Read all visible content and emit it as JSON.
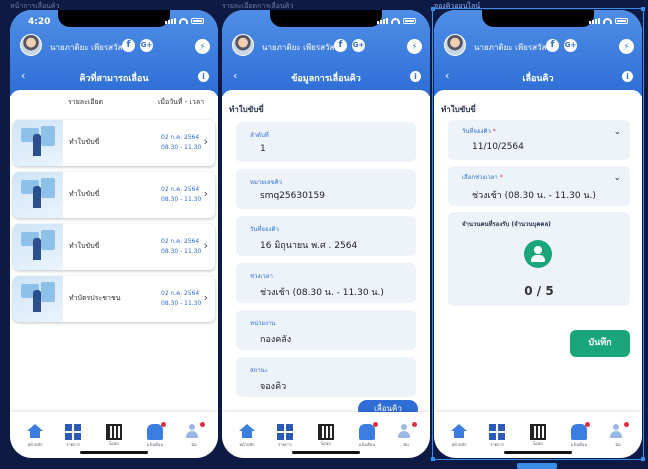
{
  "captions": [
    "หน้าการเลื่อนคิว",
    "รายละเอียดการเลื่อนคิว",
    "จองคิวออนไลน์"
  ],
  "status_time": "4:20",
  "user_name": "นายภาติยะ เพียรสวัสดิ์",
  "screen1": {
    "title": "คิวที่สามารถเลื่อน",
    "col_detail": "รายละเอียด",
    "col_date": "เมื่อวันที่ - เวลา",
    "items": [
      {
        "label": "ทำใบขับขี่",
        "date": "02 ก.ค. 2564",
        "time": "08.30 - 11.30"
      },
      {
        "label": "ทำใบขับขี่",
        "date": "02 ก.ค. 2564",
        "time": "08.30 - 11.30"
      },
      {
        "label": "ทำใบขับขี่",
        "date": "02 ก.ค. 2564",
        "time": "08.30 - 11.30"
      },
      {
        "label": "ทำบัตรประชาชน",
        "date": "02 ก.ค. 2564",
        "time": "08.30 - 11.30"
      }
    ]
  },
  "screen2": {
    "title": "ข้อมูลการเลื่อนคิว",
    "section": "ทำใบขับขี่",
    "fields": [
      {
        "label": "ลำดับที่",
        "value": "1"
      },
      {
        "label": "หมายเลขคิว",
        "value": "smq25630159"
      },
      {
        "label": "วันที่จองคิว",
        "value": "16 มิถุนายน พ.ศ . 2564"
      },
      {
        "label": "ช่วงเวลา",
        "value": "ช่วงเช้า (08.30 น. - 11.30 น.)"
      },
      {
        "label": "หน่วยงาน",
        "value": "กองคลัง"
      },
      {
        "label": "สถานะ",
        "value": "จองคิว"
      }
    ],
    "action_label": "เลื่อนคิว"
  },
  "screen3": {
    "title": "เลื่อนคิว",
    "section": "ทำใบขับขี่",
    "date_label": "วันที่จองคิว",
    "date_value": "11/10/2564",
    "slot_label": "เลือกช่วงเวลา",
    "slot_value": "ช่วงเช้า (08.30 น. - 11.30 น.)",
    "required_mark": "*",
    "capacity_label": "จำนวนคนที่รองรับ (จำนวนบุคคล)",
    "capacity_value": "0 / 5",
    "save_label": "บันทึก"
  },
  "tabs": [
    "หน้าหลัก",
    "รายการ",
    "Scan",
    "แจ้งเตือน",
    "ฉัน"
  ],
  "icons": {
    "facebook": "f",
    "google_plus": "G+",
    "messenger": "messenger-icon",
    "back": "‹",
    "info": "i",
    "chevron_right": "›",
    "chevron_down": "⌄"
  },
  "colors": {
    "primary": "#2e6ed6",
    "success": "#1aa57a",
    "alert": "#e03040"
  }
}
